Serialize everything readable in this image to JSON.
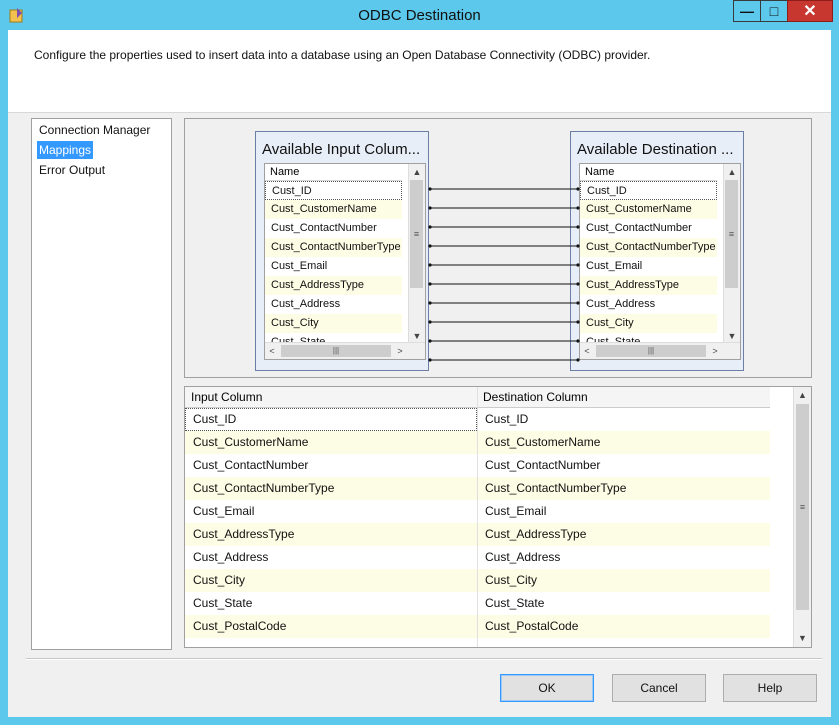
{
  "window": {
    "title": "ODBC Destination",
    "controls": {
      "minimize": "—",
      "maximize": "□",
      "close": "✕"
    }
  },
  "header": {
    "description": "Configure the properties used to insert data into a database using an Open Database Connectivity (ODBC) provider."
  },
  "nav": {
    "items": [
      "Connection Manager",
      "Mappings",
      "Error Output"
    ],
    "selected": "Mappings"
  },
  "input_table": {
    "title": "Available Input Colum...",
    "column_header": "Name",
    "rows": [
      "Cust_ID",
      "Cust_CustomerName",
      "Cust_ContactNumber",
      "Cust_ContactNumberType",
      "Cust_Email",
      "Cust_AddressType",
      "Cust_Address",
      "Cust_City",
      "Cust_State"
    ]
  },
  "destination_table": {
    "title": "Available Destination ...",
    "column_header": "Name",
    "rows": [
      "Cust_ID",
      "Cust_CustomerName",
      "Cust_ContactNumber",
      "Cust_ContactNumberType",
      "Cust_Email",
      "Cust_AddressType",
      "Cust_Address",
      "Cust_City",
      "Cust_State"
    ]
  },
  "mapping_grid": {
    "headers": {
      "input": "Input Column",
      "destination": "Destination Column"
    },
    "rows": [
      {
        "input": "Cust_ID",
        "destination": "Cust_ID"
      },
      {
        "input": "Cust_CustomerName",
        "destination": "Cust_CustomerName"
      },
      {
        "input": "Cust_ContactNumber",
        "destination": "Cust_ContactNumber"
      },
      {
        "input": "Cust_ContactNumberType",
        "destination": "Cust_ContactNumberType"
      },
      {
        "input": "Cust_Email",
        "destination": "Cust_Email"
      },
      {
        "input": "Cust_AddressType",
        "destination": "Cust_AddressType"
      },
      {
        "input": "Cust_Address",
        "destination": "Cust_Address"
      },
      {
        "input": "Cust_City",
        "destination": "Cust_City"
      },
      {
        "input": "Cust_State",
        "destination": "Cust_State"
      },
      {
        "input": "Cust_PostalCode",
        "destination": "Cust_PostalCode"
      }
    ]
  },
  "buttons": {
    "ok": "OK",
    "cancel": "Cancel",
    "help": "Help"
  },
  "icons": {
    "scroll_up": "▲",
    "scroll_down": "▼",
    "scroll_left": "<",
    "scroll_right": ">",
    "grip_vertical": "≡",
    "grip_horizontal": "|||"
  },
  "colors": {
    "titlebar": "#5bc8ec",
    "selection": "#3399ff",
    "alt_row": "#fdfce4",
    "close_button": "#c7372f"
  }
}
